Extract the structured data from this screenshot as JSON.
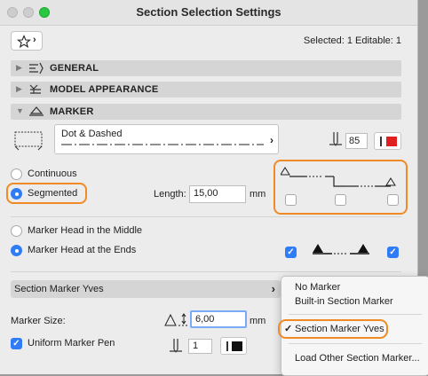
{
  "window": {
    "title": "Section Selection Settings"
  },
  "header": {
    "favorites_icon": "star-icon",
    "selection_info": "Selected: 1 Editable: 1"
  },
  "panels": {
    "general": "GENERAL",
    "model_appearance": "MODEL APPEARANCE",
    "marker": "MARKER"
  },
  "marker": {
    "line_type": "Dot & Dashed",
    "pen_number": "85",
    "pen_color": "#e02020",
    "continuous_label": "Continuous",
    "segmented_label": "Segmented",
    "selected_type": "Segmented",
    "length_label": "Length:",
    "length_value": "15,00",
    "length_unit": "mm",
    "head_middle_label": "Marker Head in the Middle",
    "head_ends_label": "Marker Head at the Ends",
    "selected_head": "Marker Head at the Ends"
  },
  "section_marker": {
    "dropdown_value": "Section Marker Yves",
    "size_label": "Marker Size:",
    "size_value": "6,00",
    "size_unit": "mm",
    "uniform_pen_label": "Uniform Marker Pen",
    "uniform_pen_checked": true,
    "pen_number": "1",
    "pen_color": "#111111"
  },
  "popup_menu": {
    "items": [
      "No Marker",
      "Built-in Section Marker",
      "Section Marker Yves",
      "Load Other Section Marker..."
    ],
    "checked_item": "Section Marker Yves",
    "check_glyph": "✓"
  },
  "colors": {
    "accent": "#2f7cf6",
    "highlight": "#f08a24",
    "panel_header": "#d5d5d5"
  }
}
